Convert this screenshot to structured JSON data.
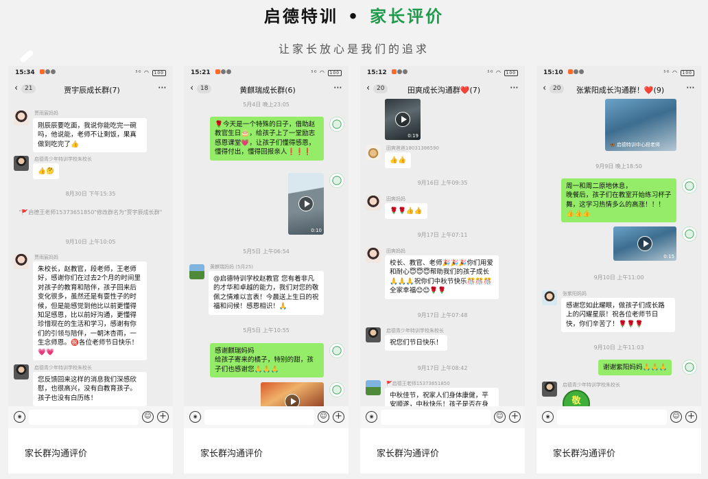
{
  "header": {
    "brand": "启德特训",
    "separator": "•",
    "title": "家长评价",
    "subtitle": "让家长放心是我们的追求"
  },
  "colors": {
    "accent": "#1d9a4a",
    "bubble_green": "#95ec69",
    "chat_bg": "#ededed"
  },
  "icons": [
    "back-chevron-icon",
    "more-icon",
    "voice-icon",
    "emoji-icon",
    "plus-icon",
    "play-icon",
    "wifi-icon",
    "battery-icon"
  ],
  "screens": [
    {
      "time": "15:34",
      "status_right": "⁵ᴳ ◠ ",
      "battery": "100",
      "back_count": "21",
      "group": "贾宇辰成长群(7)",
      "caption": "家长群沟通评价",
      "messages": {
        "m1_sender": "贾雨宸妈妈",
        "m1_text": "刚辰辰要吃面，我说你能吃完一碗吗，他说能，老师不让剩饭，果真做到吃完了👍",
        "m2_sender": "启德青少年特训学校朱校长",
        "m2_text": "👍🤔",
        "ts1": "8月30日 下午15:35",
        "sys1": "\"🚩启德王老师15373651850\"修改群名为\"贾宇辰成长群\"",
        "ts2": "9月10日 上午10:05",
        "m3_sender": "贾雨宸妈妈",
        "m3_text": "朱校长，赵教官，段老师，王老师好，感谢你们在过去2个月的时间里对孩子的教育和陪伴，孩子回来后变化很多，虽然还是有耍性子的时候，但是能感觉到他比以前更懂得知足感恩，比以前好沟通，更懂得珍惜现在的生活和学习，感谢有你们的引领与陪伴，一朝沐杏雨，一生念师恩。㊗️各位老师节日快乐！💗💗",
        "m4_sender": "启德青少年特训学校朱校长",
        "m4_text": "您反馈回来这样的消息我们深感欣慰，也很高兴，没有白教育孩子。孩子也没有白历练！"
      }
    },
    {
      "time": "15:21",
      "status_right": "⁵ᴳ ◠ ",
      "battery": "100",
      "back_count": "18",
      "group": "黄麒瑞成长群(6)",
      "caption": "家长群沟通评价",
      "messages": {
        "ts1": "5月4日 晚上23:05",
        "g1_text": "🌹今天是一个特殊的日子，借助赵教官生日🎂，给孩子上了一堂励志感恩课堂💗，让孩子们懂得感恩，懂得付出，懂得回报亲人❗❗❗",
        "v1_dur": "0:10",
        "ts2": "5月5日 上午06:54",
        "m1_sender": "黄麒瑞妈妈 (5月25)",
        "m1_text": "@启德特训学校赵教官  您有着非凡的才华和卓越的能力，我们对您的敬佩之情难以言表！今晨送上生日的祝福和问候！感恩相识！🙏",
        "ts3": "5月5日 上午10:55",
        "g2_text": "感谢麒瑞妈妈\n给孩子寄来的橘子，特别的甜，孩子们也感谢您🙏🙏🙏"
      }
    },
    {
      "time": "15:12",
      "status_right": "⁵ᴳ ◠ ",
      "battery": "100",
      "back_count": "20",
      "group": "田爽成长沟通群❤️(7)",
      "caption": "家长群沟通评价",
      "messages": {
        "v1_dur": "0:19",
        "m1_sender": "田爽爸爸18031386590",
        "m1_text": "👍👍",
        "ts1": "9月16日 上午09:35",
        "m2_sender": "田爽妈妈",
        "m2_text": "🌹🌹👍👍",
        "ts2": "9月17日 上午07:11",
        "m3_sender": "田爽妈妈",
        "m3_text": "校长、教官、老师🎉🎉🎉你们用爱和耐心😇😇😇帮助我们的孩子成长🙏🙏🙏祝你们中秋节快乐🎊🎊🎊全家幸福😊😊🌹🌹",
        "ts3": "9月17日 上午07:48",
        "m4_sender": "启德青少年特训学校朱校长",
        "m4_text": "祝您们节日快乐！",
        "ts4": "9月17日 上午08:42",
        "m5_sender": "🚩启德王老师15373651850",
        "m5_text": "中秋佳节，祝家人们身体康健，平安顺遂，中秋快乐！孩子是否在身"
      }
    },
    {
      "time": "15:10",
      "status_right": "⁵ᴳ ◠ ",
      "battery": "100",
      "back_count": "20",
      "group": "张紫阳成长沟通群！❤️(9)",
      "caption": "家长群沟通评价",
      "messages": {
        "v1_brand": "🦋 启德特训中心段老师",
        "ts1": "9月9日 晚上18:50",
        "g1_text": "周一和周二原地休息，\n晚餐后，孩子们在教室开始练习杯子舞，这学习热情多么的高涨！！！👍👍👍",
        "v2_dur": "0:15",
        "ts2": "9月10日 上午11:00",
        "m1_sender": "张紫阳妈妈",
        "m1_text": "感谢您如此耀眼，做孩子们成长路上的闪耀星辰！祝各位老师节日快，你们辛苦了！🌹🌹🌹",
        "ts3": "9月10日 上午11:03",
        "g2_text": "谢谢紫阳妈妈🙏🙏🙏",
        "m2_sender": "启德青少年特训学校朱校长",
        "sticker": "敬"
      }
    }
  ]
}
